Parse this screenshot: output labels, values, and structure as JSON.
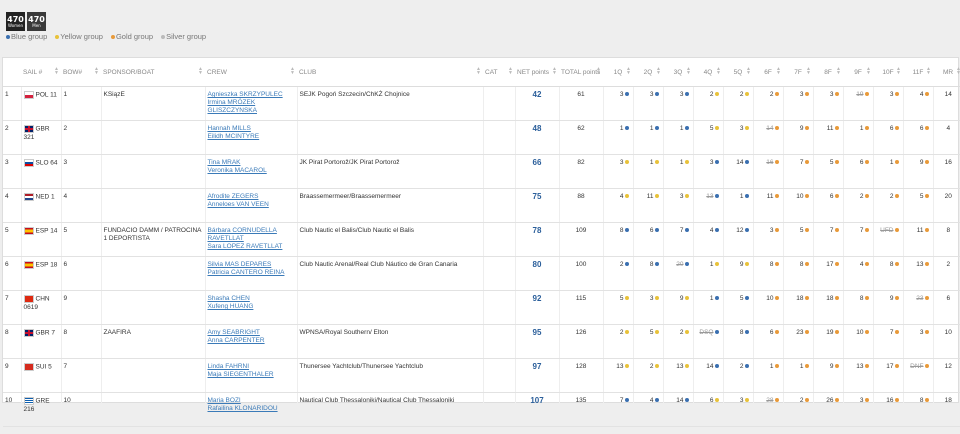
{
  "logos": [
    {
      "text": "470",
      "sub": "Women"
    },
    {
      "text": "470",
      "sub": "Men"
    }
  ],
  "legend": [
    {
      "label": "Blue group",
      "color": "#3a6fb0"
    },
    {
      "label": "Yellow group",
      "color": "#e8c23a"
    },
    {
      "label": "Gold group",
      "color": "#e89a3a"
    },
    {
      "label": "Silver group",
      "color": "#bbbbbb"
    }
  ],
  "headers": [
    "",
    "SAIL #",
    "BOW#",
    "SPONSOR/BOAT",
    "CREW",
    "CLUB",
    "CAT",
    "NET points",
    "TOTAL points",
    "1Q",
    "2Q",
    "3Q",
    "4Q",
    "5Q",
    "6F",
    "7F",
    "8F",
    "9F",
    "10F",
    "11F",
    "MR"
  ],
  "colors": {
    "blue": "#3a6fb0",
    "yellow": "#e8c23a",
    "gold": "#e89a3a",
    "silver": "#bbbbbb"
  },
  "rows": [
    {
      "rank": "1",
      "flag": "pol",
      "sail": "POL 11",
      "bow": "1",
      "sponsor": "KSiązE",
      "crew": [
        "Agnieszka SKRZYPULEC",
        "Irmina MRÓZEK GLISZCZYNSKA"
      ],
      "club": "SEJK Pogoń Szczecin/ChKŻ Chojnice",
      "net": "42",
      "total": "61",
      "scores": [
        [
          "3",
          "blue"
        ],
        [
          "3",
          "blue"
        ],
        [
          "3",
          "blue"
        ],
        [
          "2",
          "yellow"
        ],
        [
          "2",
          "yellow"
        ],
        [
          "2",
          "gold"
        ],
        [
          "3",
          "gold"
        ],
        [
          "3",
          "gold"
        ],
        [
          "19",
          "gold",
          1
        ],
        [
          "3",
          "gold"
        ],
        [
          "4",
          "gold"
        ]
      ],
      "mr": "14"
    },
    {
      "rank": "2",
      "flag": "gbr",
      "sail": "GBR 321",
      "bow": "2",
      "sponsor": "",
      "crew": [
        "Hannah MILLS",
        "Eilidh MCINTYRE"
      ],
      "club": "",
      "net": "48",
      "total": "62",
      "scores": [
        [
          "1",
          "blue"
        ],
        [
          "1",
          "blue"
        ],
        [
          "1",
          "blue"
        ],
        [
          "5",
          "yellow"
        ],
        [
          "3",
          "yellow"
        ],
        [
          "14",
          "gold",
          1
        ],
        [
          "9",
          "gold"
        ],
        [
          "11",
          "gold"
        ],
        [
          "1",
          "gold"
        ],
        [
          "6",
          "gold"
        ],
        [
          "6",
          "gold"
        ]
      ],
      "mr": "4"
    },
    {
      "rank": "3",
      "flag": "slo",
      "sail": "SLO 64",
      "bow": "3",
      "sponsor": "",
      "crew": [
        "Tina MRAK",
        "Veronika MACAROL"
      ],
      "club": "JK Pirat Portorož/JK Pirat Portorož",
      "net": "66",
      "total": "82",
      "scores": [
        [
          "3",
          "yellow"
        ],
        [
          "1",
          "yellow"
        ],
        [
          "1",
          "yellow"
        ],
        [
          "3",
          "blue"
        ],
        [
          "14",
          "blue"
        ],
        [
          "16",
          "gold",
          1
        ],
        [
          "7",
          "gold"
        ],
        [
          "5",
          "gold"
        ],
        [
          "6",
          "gold"
        ],
        [
          "1",
          "gold"
        ],
        [
          "9",
          "gold"
        ]
      ],
      "mr": "16"
    },
    {
      "rank": "4",
      "flag": "ned",
      "sail": "NED 1",
      "bow": "4",
      "sponsor": "",
      "crew": [
        "Afrodite ZEGERS",
        "Anneloes VAN VEEN"
      ],
      "club": "Braassemermeer/Braassemermeer",
      "net": "75",
      "total": "88",
      "scores": [
        [
          "4",
          "yellow"
        ],
        [
          "11",
          "yellow"
        ],
        [
          "3",
          "yellow"
        ],
        [
          "13",
          "blue",
          1
        ],
        [
          "1",
          "blue"
        ],
        [
          "11",
          "gold"
        ],
        [
          "10",
          "gold"
        ],
        [
          "6",
          "gold"
        ],
        [
          "2",
          "gold"
        ],
        [
          "2",
          "gold"
        ],
        [
          "5",
          "gold"
        ]
      ],
      "mr": "20"
    },
    {
      "rank": "5",
      "flag": "esp",
      "sail": "ESP 14",
      "bow": "5",
      "sponsor": "FUNDACIO DAMM / PATROCINA 1 DEPORTISTA",
      "crew": [
        "Bárbara CORNUDELLA RAVETLLAT",
        "Sara LOPEZ RAVETLLAT"
      ],
      "club": "Club Nautic el Balis/Club Nautic el Balis",
      "net": "78",
      "total": "109",
      "scores": [
        [
          "8",
          "blue"
        ],
        [
          "6",
          "blue"
        ],
        [
          "7",
          "blue"
        ],
        [
          "4",
          "blue"
        ],
        [
          "12",
          "blue"
        ],
        [
          "3",
          "gold"
        ],
        [
          "5",
          "gold"
        ],
        [
          "7",
          "gold"
        ],
        [
          "7",
          "gold"
        ],
        [
          "UFD",
          "gold",
          1
        ],
        [
          "11",
          "gold"
        ]
      ],
      "mr": "8"
    },
    {
      "rank": "6",
      "flag": "esp",
      "sail": "ESP 18",
      "bow": "6",
      "sponsor": "",
      "crew": [
        "Silvia MAS DEPARES",
        "Patricia CANTERO REINA"
      ],
      "club": "Club Nautic Arenal/Real Club Náutico de Gran Canaria",
      "net": "80",
      "total": "100",
      "scores": [
        [
          "2",
          "blue"
        ],
        [
          "8",
          "blue"
        ],
        [
          "20",
          "blue",
          1
        ],
        [
          "1",
          "yellow"
        ],
        [
          "9",
          "yellow"
        ],
        [
          "8",
          "gold"
        ],
        [
          "8",
          "gold"
        ],
        [
          "17",
          "gold"
        ],
        [
          "4",
          "gold"
        ],
        [
          "8",
          "gold"
        ],
        [
          "13",
          "gold"
        ]
      ],
      "mr": "2"
    },
    {
      "rank": "7",
      "flag": "chn",
      "sail": "CHN 0619",
      "bow": "9",
      "sponsor": "",
      "crew": [
        "Shasha CHEN",
        "Xufeng HUANG"
      ],
      "club": "",
      "net": "92",
      "total": "115",
      "scores": [
        [
          "5",
          "yellow"
        ],
        [
          "3",
          "yellow"
        ],
        [
          "9",
          "yellow"
        ],
        [
          "1",
          "blue"
        ],
        [
          "5",
          "blue"
        ],
        [
          "10",
          "gold"
        ],
        [
          "18",
          "gold"
        ],
        [
          "18",
          "gold"
        ],
        [
          "8",
          "gold"
        ],
        [
          "9",
          "gold"
        ],
        [
          "23",
          "gold",
          1
        ]
      ],
      "mr": "6"
    },
    {
      "rank": "8",
      "flag": "gbr",
      "sail": "GBR 7",
      "bow": "8",
      "sponsor": "ZAAFIRA",
      "crew": [
        "Amy SEABRIGHT",
        "Anna CARPENTER"
      ],
      "club": "WPNSA/Royal Southern/ Elton",
      "net": "95",
      "total": "126",
      "scores": [
        [
          "2",
          "yellow"
        ],
        [
          "5",
          "yellow"
        ],
        [
          "2",
          "yellow"
        ],
        [
          "DSQ",
          "blue",
          1
        ],
        [
          "8",
          "blue"
        ],
        [
          "6",
          "gold"
        ],
        [
          "23",
          "gold"
        ],
        [
          "19",
          "gold"
        ],
        [
          "10",
          "gold"
        ],
        [
          "7",
          "gold"
        ],
        [
          "3",
          "gold"
        ]
      ],
      "mr": "10"
    },
    {
      "rank": "9",
      "flag": "sui",
      "sail": "SUI 5",
      "bow": "7",
      "sponsor": "",
      "crew": [
        "Linda FAHRNI",
        "Maja SIEGENTHALER"
      ],
      "club": "Thunersee Yachtclub/Thunersee Yachtclub",
      "net": "97",
      "total": "128",
      "scores": [
        [
          "13",
          "yellow"
        ],
        [
          "2",
          "yellow"
        ],
        [
          "13",
          "yellow"
        ],
        [
          "14",
          "blue"
        ],
        [
          "2",
          "blue"
        ],
        [
          "1",
          "gold"
        ],
        [
          "1",
          "gold"
        ],
        [
          "9",
          "gold"
        ],
        [
          "13",
          "gold"
        ],
        [
          "17",
          "gold"
        ],
        [
          "DNF",
          "gold",
          1
        ]
      ],
      "mr": "12"
    },
    {
      "rank": "10",
      "flag": "gre",
      "sail": "GRE 216",
      "bow": "10",
      "sponsor": "",
      "crew": [
        "Maria BOZI",
        "Rafailina KLONARIDOU"
      ],
      "club": "Nautical Club Thessaloniki/Nautical Club Thessaloniki",
      "net": "107",
      "total": "135",
      "scores": [
        [
          "7",
          "blue"
        ],
        [
          "4",
          "blue"
        ],
        [
          "14",
          "blue"
        ],
        [
          "6",
          "yellow"
        ],
        [
          "3",
          "yellow"
        ],
        [
          "28",
          "gold",
          1
        ],
        [
          "2",
          "gold"
        ],
        [
          "26",
          "gold"
        ],
        [
          "3",
          "gold"
        ],
        [
          "16",
          "gold"
        ],
        [
          "8",
          "gold"
        ]
      ],
      "mr": "18"
    }
  ]
}
